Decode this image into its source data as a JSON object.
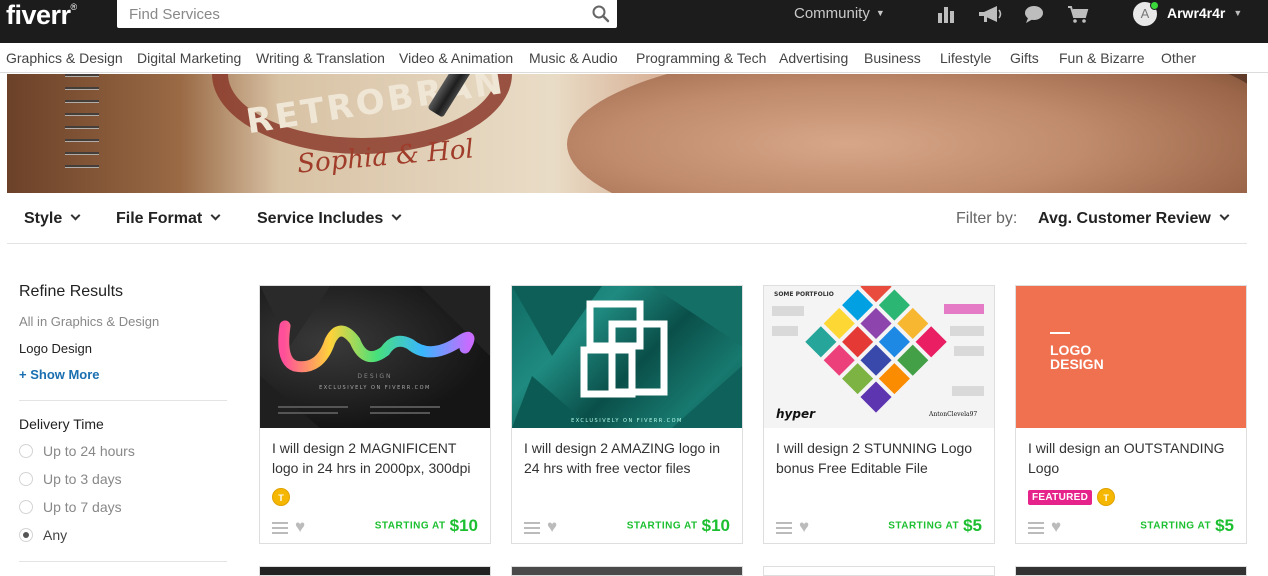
{
  "header": {
    "logo": "fiverr",
    "logo_mark": "®",
    "search_placeholder": "Find Services",
    "community_label": "Community",
    "avatar_initial": "A",
    "username": "Arwr4r4r"
  },
  "categories": [
    "Graphics & Design",
    "Digital Marketing",
    "Writing & Translation",
    "Video & Animation",
    "Music & Audio",
    "Programming & Tech",
    "Advertising",
    "Business",
    "Lifestyle",
    "Gifts",
    "Fun & Bizarre",
    "Other"
  ],
  "banner": {
    "brand_text": "RETROBRAN",
    "script_text": "Sophia & Hol"
  },
  "filters": {
    "style": "Style",
    "file_format": "File Format",
    "service_includes": "Service Includes",
    "filter_by_label": "Filter by:",
    "sort_value": "Avg. Customer Review"
  },
  "sidebar": {
    "refine_title": "Refine Results",
    "all_in": "All in Graphics & Design",
    "current": "Logo Design",
    "show_more": "+ Show More",
    "delivery_title": "Delivery Time",
    "delivery_options": [
      "Up to 24 hours",
      "Up to 3 days",
      "Up to 7 days",
      "Any"
    ],
    "delivery_selected": "Any"
  },
  "gigs": [
    {
      "title": "I will design 2 MAGNIFICENT logo in 24 hrs in 2000px, 300dpi",
      "level_badge": "T",
      "featured": "",
      "starting_label": "STARTING AT",
      "price": "$10"
    },
    {
      "title": "I will design 2 AMAZING logo in 24 hrs with free vector files",
      "level_badge": "",
      "featured": "",
      "starting_label": "STARTING AT",
      "price": "$10"
    },
    {
      "title": "I will design 2 STUNNING Logo bonus Free Editable File",
      "level_badge": "",
      "featured": "",
      "starting_label": "STARTING AT",
      "price": "$5"
    },
    {
      "title": "I will design an OUTSTANDING Logo",
      "level_badge": "T",
      "featured": "FEATURED",
      "starting_label": "STARTING AT",
      "price": "$5"
    }
  ],
  "thumbs": {
    "t1_word": "Logo",
    "t1_sub": "DESIGN",
    "t1_foot": "EXCLUSIVELY ON FIVERR.COM",
    "t2_foot": "EXCLUSIVELY ON FIVERR.COM",
    "t3_head": "SOME PORTFOLIO",
    "t3_sign": "AntonClevela97",
    "t3_hyper": "hyper",
    "t4_line1": "LOGO",
    "t4_line2": "DESIGN"
  },
  "colors": {
    "topbar": "#1c1c1c",
    "price_green": "#1cbf30",
    "featured_pink": "#e5238a",
    "level_gold": "#f5b700",
    "link_blue": "#1a6fb0"
  }
}
